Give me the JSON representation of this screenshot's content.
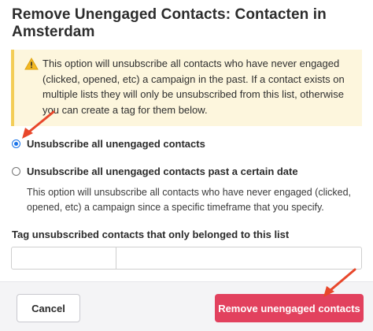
{
  "modal": {
    "title": "Remove Unengaged Contacts: Contacten in Amsterdam"
  },
  "warning": {
    "icon": "warning-icon",
    "text": "This option will unsubscribe all contacts who have never engaged (clicked, opened, etc) a campaign in the past. If a contact exists on multiple lists they will only be unsubscribed from this list, otherwise you can create a tag for them below."
  },
  "options": [
    {
      "label": "Unsubscribe all unengaged contacts",
      "checked": true
    },
    {
      "label": "Unsubscribe all unengaged contacts past a certain date",
      "checked": false,
      "description": "This option will unsubscribe all contacts who have never engaged (clicked, opened, etc) a campaign since a specific timeframe that you specify."
    }
  ],
  "tag": {
    "label": "Tag unsubscribed contacts that only belonged to this list",
    "value": ""
  },
  "footer": {
    "cancel_label": "Cancel",
    "remove_label": "Remove unengaged contacts"
  },
  "colors": {
    "primary_button": "#e2415e",
    "warning_bg": "#fdf6dd",
    "warning_border": "#f3cd57",
    "annotation_arrow": "#e8472b"
  }
}
